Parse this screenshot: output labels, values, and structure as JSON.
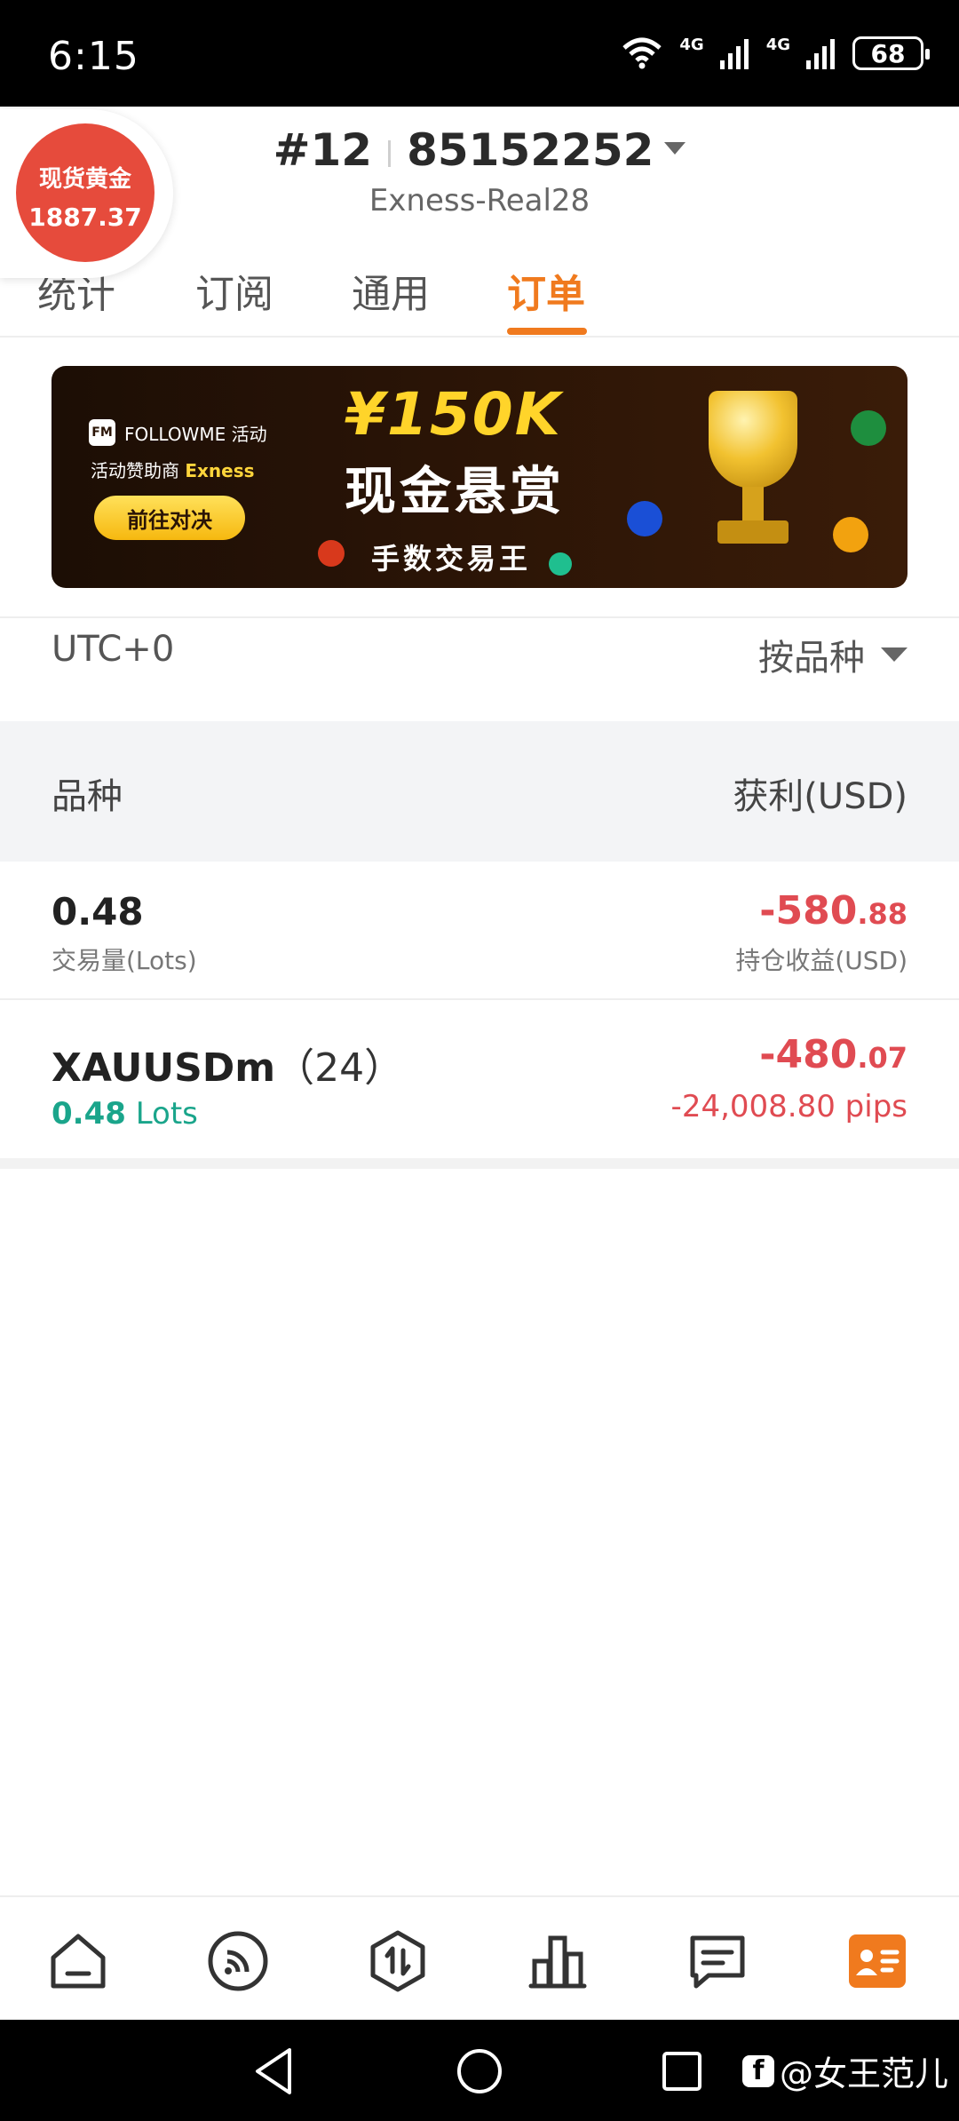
{
  "status_bar": {
    "time": "6:15",
    "network_1": "4G",
    "network_2": "4G",
    "battery": "68"
  },
  "header": {
    "account_prefix": "#12",
    "account_number": "85152252",
    "server": "Exness-Real28"
  },
  "gold_badge": {
    "label": "现货黄金",
    "price": "1887.37"
  },
  "tabs": [
    {
      "label": "统计",
      "active": false
    },
    {
      "label": "订阅",
      "active": false
    },
    {
      "label": "通用",
      "active": false
    },
    {
      "label": "订单",
      "active": true
    }
  ],
  "banner": {
    "brand": "FOLLOWME 活动",
    "sponsor_prefix": "活动赞助商",
    "sponsor_name": "Exness",
    "button": "前往对决",
    "amount": "¥150K",
    "title": "现金悬赏",
    "subtitle": "手数交易王"
  },
  "filter": {
    "timezone": "UTC+0",
    "group_by": "按品种"
  },
  "table_header": {
    "symbol": "品种",
    "profit": "获利(USD)"
  },
  "summary": {
    "volume": "0.48",
    "volume_label": "交易量(Lots)",
    "profit_int": "-580",
    "profit_dec": ".88",
    "profit_label": "持仓收益(USD)"
  },
  "positions": [
    {
      "symbol": "XAUUSDm",
      "count": "（24）",
      "lots_value": "0.48",
      "lots_unit": "Lots",
      "profit_int": "-480",
      "profit_dec": ".07",
      "pips": "-24,008.80 pips"
    }
  ],
  "bottom_nav": {
    "active_index": 5,
    "active_color": "#f07a1e",
    "items": [
      "home-icon",
      "feed-icon",
      "trade-icon",
      "ranking-icon",
      "message-icon",
      "profile-card-icon"
    ]
  },
  "watermark": "@女王范儿"
}
